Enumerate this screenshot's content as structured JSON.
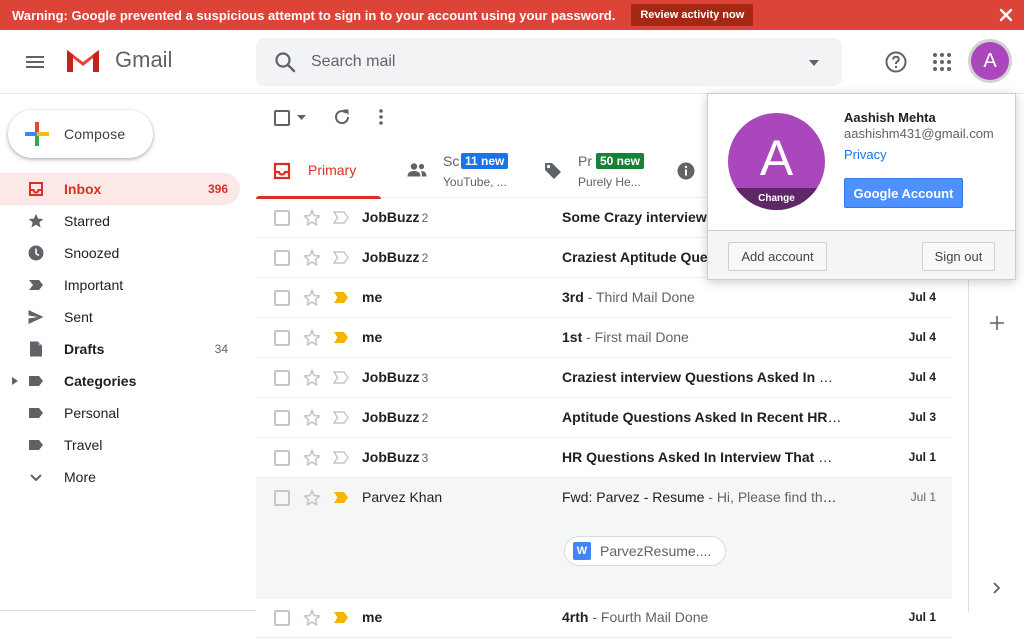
{
  "banner": {
    "message": "Warning: Google prevented a suspicious attempt to sign in to your account using your password.",
    "review_label": "Review activity now"
  },
  "header": {
    "app_name": "Gmail",
    "search_placeholder": "Search mail",
    "avatar_letter": "A"
  },
  "sidebar": {
    "compose_label": "Compose",
    "items": [
      {
        "label": "Inbox",
        "count": "396",
        "icon": "inbox-icon"
      },
      {
        "label": "Starred",
        "count": "",
        "icon": "star-icon"
      },
      {
        "label": "Snoozed",
        "count": "",
        "icon": "clock-icon"
      },
      {
        "label": "Important",
        "count": "",
        "icon": "important-icon"
      },
      {
        "label": "Sent",
        "count": "",
        "icon": "send-icon"
      },
      {
        "label": "Drafts",
        "count": "34",
        "icon": "draft-icon"
      },
      {
        "label": "Categories",
        "count": "",
        "icon": "label-icon"
      },
      {
        "label": "Personal",
        "count": "",
        "icon": "label-icon"
      },
      {
        "label": "Travel",
        "count": "",
        "icon": "label-icon"
      },
      {
        "label": "More",
        "count": "",
        "icon": "chevron-down-icon"
      }
    ]
  },
  "tabs": {
    "primary": {
      "label": "Primary"
    },
    "social": {
      "name": "Sc",
      "badge": "11 new",
      "sub": "YouTube, ..."
    },
    "promotions": {
      "name": "Pr",
      "badge": "50 new",
      "sub": "Purely He..."
    }
  },
  "mails": [
    {
      "sender": "JobBuzz",
      "count": "2",
      "subject": "Some Crazy interview",
      "snippet": "",
      "date": "",
      "unread": true
    },
    {
      "sender": "JobBuzz",
      "count": "2",
      "subject": "Craziest Aptitude Ques",
      "snippet": "",
      "date": "",
      "unread": true
    },
    {
      "sender": "me",
      "count": "",
      "subject": "3rd",
      "snippet": " - Third Mail Done",
      "date": "Jul 4",
      "unread": true
    },
    {
      "sender": "me",
      "count": "",
      "subject": "1st",
      "snippet": " - First mail Done",
      "date": "Jul 4",
      "unread": true
    },
    {
      "sender": "JobBuzz",
      "count": "3",
      "subject": "Craziest interview Questions Asked In Re...",
      "snippet": "",
      "date": "Jul 4",
      "unread": true
    },
    {
      "sender": "JobBuzz",
      "count": "2",
      "subject": "Aptitude Questions Asked In Recent HR R...",
      "snippet": "",
      "date": "Jul 3",
      "unread": true
    },
    {
      "sender": "JobBuzz",
      "count": "3",
      "subject": "HR Questions Asked In Interview That Ca...",
      "snippet": "",
      "date": "Jul 1",
      "unread": true
    },
    {
      "sender": "Parvez Khan",
      "count": "",
      "subject": "Fwd: Parvez - Resume",
      "snippet": " - Hi, Please find the...",
      "date": "Jul 1",
      "unread": false,
      "attachment": "ParvezResume...."
    },
    {
      "sender": "me",
      "count": "",
      "subject": "4rth",
      "snippet": " - Fourth Mail Done",
      "date": "Jul 1",
      "unread": true
    }
  ],
  "account": {
    "name": "Aashish Mehta",
    "email": "aashishm431@gmail.com",
    "privacy_label": "Privacy",
    "google_account_label": "Google Account",
    "change_label": "Change",
    "avatar_letter": "A",
    "add_account_label": "Add account",
    "sign_out_label": "Sign out"
  },
  "colors": {
    "banner": "#db4437",
    "accent_red": "#d93025",
    "avatar": "#ab47bc",
    "social_badge": "#1a73e8",
    "promo_badge": "#188038",
    "important_marker": "#f4b400"
  }
}
